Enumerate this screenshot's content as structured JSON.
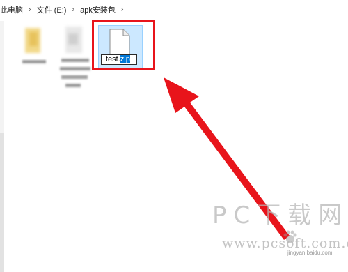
{
  "breadcrumb": {
    "items": [
      "此电脑",
      "文件 (E:)",
      "apk安装包"
    ],
    "separator": "›"
  },
  "selected_file": {
    "name_prefix": "test.",
    "name_selected": "zip"
  },
  "watermark": {
    "title": "PC下载网",
    "url": "www.pcsoft.com.cn",
    "source": "jingyan.baidu.com"
  },
  "colors": {
    "highlight": "#e8141b",
    "selection_bg": "#cce8ff",
    "text_selection": "#0078d7"
  }
}
